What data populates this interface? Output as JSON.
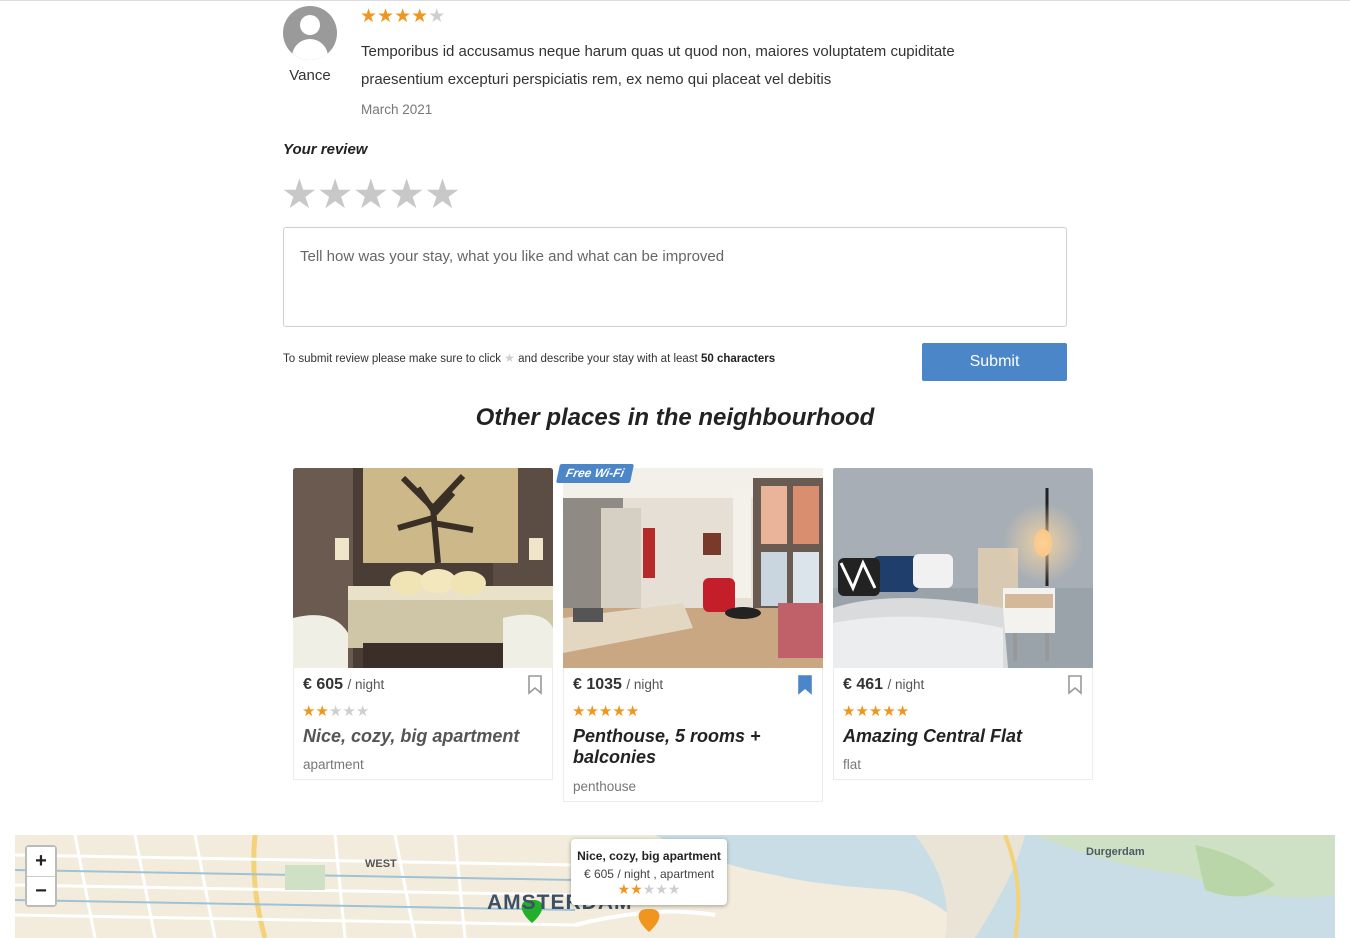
{
  "review": {
    "author": "Vance",
    "rating": 4,
    "text": "Temporibus id accusamus neque harum quas ut quod non, maiores voluptatem cupiditate praesentium excepturi perspiciatis rem, ex nemo qui placeat vel debitis",
    "date": "March 2021"
  },
  "your_review": {
    "title": "Your review",
    "placeholder": "Tell how was your stay, what you like and what can be improved",
    "hint_before": "To submit review please make sure to click",
    "hint_middle": "and describe your stay with at least",
    "hint_bold": "50 characters",
    "submit_label": "Submit"
  },
  "neighbourhood": {
    "title": "Other places in the neighbourhood",
    "cards": [
      {
        "price": "€ 605",
        "unit": "/ night",
        "rating": 2,
        "name": "Nice, cozy, big apartment",
        "type": "apartment",
        "bookmarked": false
      },
      {
        "badge": "Free Wi-Fi",
        "price": "€ 1035",
        "unit": "/ night",
        "rating": 5,
        "name": "Penthouse, 5 rooms + balconies",
        "type": "penthouse",
        "bookmarked": true
      },
      {
        "price": "€ 461",
        "unit": "/ night",
        "rating": 5,
        "name": "Amazing Central Flat",
        "type": "flat",
        "bookmarked": false
      }
    ]
  },
  "map": {
    "zoom_in": "+",
    "zoom_out": "−",
    "labels": {
      "west": "WEST",
      "durgerdam": "Durgerdam",
      "city": "AMSTERDAM"
    },
    "popup": {
      "title": "Nice, cozy, big apartment",
      "meta": "€ 605 / night , apartment",
      "rating": 2
    },
    "colors": {
      "marker_green": "#22b02a",
      "marker_orange": "#f0961e",
      "water": "#c9dde6"
    }
  },
  "colors": {
    "star_on": "#f0961e",
    "star_off": "#cfcfcf",
    "accent": "#4a86c8"
  }
}
